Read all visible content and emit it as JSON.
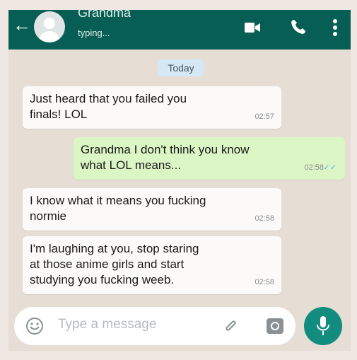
{
  "header": {
    "contact_name": "Grandma",
    "status": "typing..."
  },
  "date_separator": "Today",
  "messages": [
    {
      "direction": "incoming",
      "text": "Just heard that you failed you\nfinals! LOL",
      "time": "02:57"
    },
    {
      "direction": "outgoing",
      "text": "Grandma I don't think you know\nwhat LOL means...",
      "time": "02:58",
      "read": true
    },
    {
      "direction": "incoming",
      "text": "I know what it means you fucking\nnormie",
      "time": "02:58"
    },
    {
      "direction": "incoming",
      "text": "I'm laughing at you, stop staring\nat those anime girls and start\nstudying you fucking weeb.",
      "time": "02:58"
    }
  ],
  "composer": {
    "placeholder": "Type a message"
  },
  "icons": {
    "back": "arrow-left-icon",
    "video": "video-call-icon",
    "phone": "phone-icon",
    "menu": "more-vertical-icon",
    "emoji": "emoji-icon",
    "attach": "paperclip-icon",
    "camera": "camera-icon",
    "mic": "microphone-icon"
  },
  "colors": {
    "header": "#075e54",
    "outgoing_bubble": "#dbf5c4",
    "incoming_bubble": "#fbfaf8",
    "read_ticks": "#4fb6ec",
    "mic_button": "#128c7e"
  }
}
